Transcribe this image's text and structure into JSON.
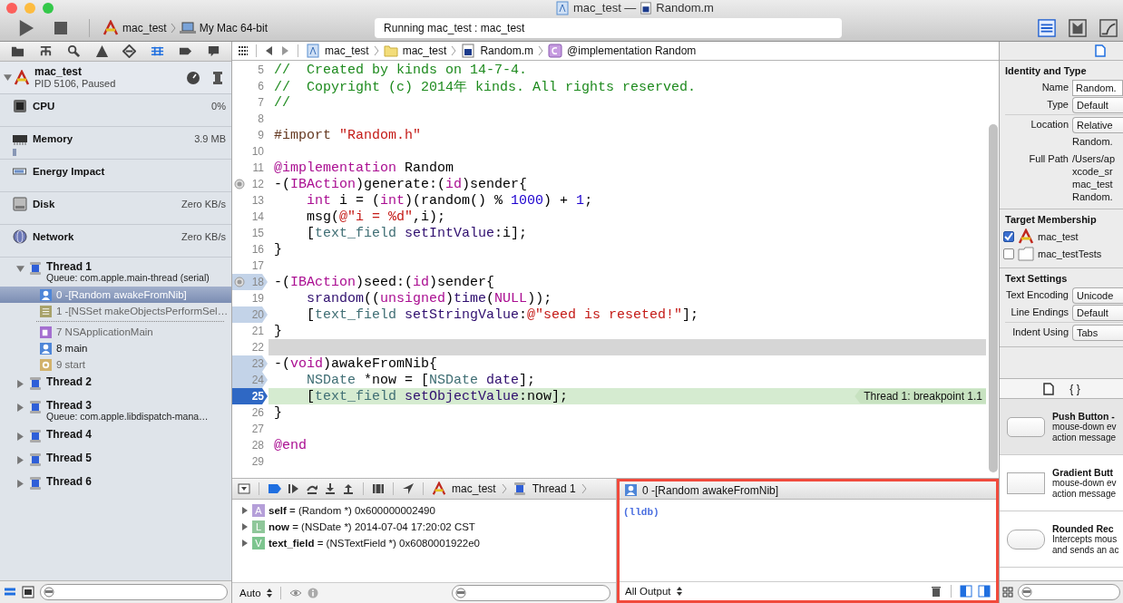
{
  "window": {
    "title_project": "mac_test —",
    "title_file": "Random.m"
  },
  "toolbar": {
    "scheme": "mac_test",
    "destination": "My Mac 64-bit",
    "activity": "Running mac_test : mac_test",
    "view_buttons": [
      {
        "kind": "navigator",
        "selected": true
      },
      {
        "kind": "debug",
        "selected": false
      },
      {
        "kind": "utilities",
        "selected": false
      }
    ]
  },
  "navigator": {
    "tabs": [
      {
        "kind": "folder",
        "selected": false
      },
      {
        "kind": "hierarchy",
        "selected": false
      },
      {
        "kind": "search",
        "selected": false
      },
      {
        "kind": "warning",
        "selected": false
      },
      {
        "kind": "test",
        "selected": false
      },
      {
        "kind": "debug",
        "selected": true
      },
      {
        "kind": "breakpoint",
        "selected": false
      },
      {
        "kind": "log",
        "selected": false
      }
    ],
    "process": {
      "name": "mac_test",
      "status": "PID 5106, Paused"
    },
    "gauges": [
      {
        "kind": "cpu",
        "name": "CPU",
        "value": "0%"
      },
      {
        "kind": "memory",
        "name": "Memory",
        "value": "3.9 MB"
      },
      {
        "kind": "energy",
        "name": "Energy Impact"
      },
      {
        "kind": "disk",
        "name": "Disk",
        "value": "Zero KB/s"
      },
      {
        "kind": "network",
        "name": "Network",
        "value": "Zero KB/s"
      }
    ],
    "threads": [
      {
        "name": "Thread 1",
        "queue": "Queue: com.apple.main-thread (serial)",
        "expanded": true,
        "frames": [
          {
            "kind": "person",
            "label": "0 -[Random awakeFromNib]",
            "selected": true,
            "dim": false
          },
          {
            "kind": "list",
            "label": "1 -[NSSet makeObjectsPerformSel…",
            "selected": false,
            "dim": true
          },
          {
            "kind": "elided"
          },
          {
            "kind": "cup",
            "label": "7 NSApplicationMain",
            "selected": false,
            "dim": true
          },
          {
            "kind": "person",
            "label": "8 main",
            "selected": false,
            "dim": false
          },
          {
            "kind": "gear",
            "label": "9 start",
            "selected": false,
            "dim": true
          }
        ]
      },
      {
        "name": "Thread 2",
        "expanded": false
      },
      {
        "name": "Thread 3",
        "queue": "Queue: com.apple.libdispatch-mana…",
        "expanded": false
      },
      {
        "name": "Thread 4",
        "expanded": false
      },
      {
        "name": "Thread 5",
        "expanded": false
      },
      {
        "name": "Thread 6",
        "expanded": false
      }
    ]
  },
  "jump_bar": [
    {
      "kind": "project",
      "text": "mac_test"
    },
    {
      "kind": "folder",
      "text": "mac_test"
    },
    {
      "kind": "file",
      "text": "Random.m"
    },
    {
      "kind": "class",
      "text": "@implementation Random"
    }
  ],
  "editor": {
    "lines": [
      {
        "number": "5",
        "kind": "plain",
        "highlighted": false,
        "current": false,
        "tokens": [
          {
            "kind": "comment",
            "text": "//  Created by kinds on 14-7-4."
          }
        ]
      },
      {
        "number": "6",
        "kind": "plain",
        "highlighted": false,
        "current": false,
        "tokens": [
          {
            "kind": "comment",
            "text": "//  Copyright (c) 2014年 kinds. All rights reserved."
          }
        ]
      },
      {
        "number": "7",
        "kind": "plain",
        "highlighted": false,
        "current": false,
        "tokens": [
          {
            "kind": "comment",
            "text": "//"
          }
        ]
      },
      {
        "number": "8",
        "kind": "plain",
        "highlighted": false,
        "current": false
      },
      {
        "number": "9",
        "kind": "plain",
        "highlighted": false,
        "current": false,
        "tokens": [
          {
            "kind": "preprocessor",
            "text": "#import "
          },
          {
            "kind": "string",
            "text": "\"Random.h\""
          }
        ]
      },
      {
        "number": "10",
        "kind": "plain",
        "highlighted": false,
        "current": false
      },
      {
        "number": "11",
        "kind": "plain",
        "highlighted": false,
        "current": false,
        "tokens": [
          {
            "kind": "keyword",
            "text": "@implementation"
          },
          {
            "kind": "plain",
            "text": " Random"
          }
        ]
      },
      {
        "number": "12",
        "kind": "circle",
        "highlighted": false,
        "current": false,
        "tokens": [
          {
            "kind": "plain",
            "text": "-("
          },
          {
            "kind": "keyword",
            "text": "IBAction"
          },
          {
            "kind": "plain",
            "text": ")generate:("
          },
          {
            "kind": "keyword",
            "text": "id"
          },
          {
            "kind": "plain",
            "text": ")sender{"
          }
        ]
      },
      {
        "number": "13",
        "kind": "plain",
        "highlighted": false,
        "current": false,
        "tokens": [
          {
            "kind": "keyword",
            "text": "    int"
          },
          {
            "kind": "plain",
            "text": " i = ("
          },
          {
            "kind": "keyword",
            "text": "int"
          },
          {
            "kind": "plain",
            "text": ")(random() % "
          },
          {
            "kind": "number",
            "text": "1000"
          },
          {
            "kind": "plain",
            "text": ") + "
          },
          {
            "kind": "number",
            "text": "1"
          },
          {
            "kind": "plain",
            "text": ";"
          }
        ]
      },
      {
        "number": "14",
        "kind": "plain",
        "highlighted": false,
        "current": false,
        "tokens": [
          {
            "kind": "plain",
            "text": "    msg("
          },
          {
            "kind": "string",
            "text": "@\"i = %d\""
          },
          {
            "kind": "plain",
            "text": ",i);"
          }
        ]
      },
      {
        "number": "15",
        "kind": "plain",
        "highlighted": false,
        "current": false,
        "tokens": [
          {
            "kind": "plain",
            "text": "    ["
          },
          {
            "kind": "type",
            "text": "text_field"
          },
          {
            "kind": "method",
            "text": " setIntValue"
          },
          {
            "kind": "plain",
            "text": ":i];"
          }
        ]
      },
      {
        "number": "16",
        "kind": "plain",
        "highlighted": false,
        "current": false,
        "tokens": [
          {
            "kind": "plain",
            "text": "}"
          }
        ]
      },
      {
        "number": "17",
        "kind": "plain",
        "highlighted": false,
        "current": false
      },
      {
        "number": "18",
        "kind": "circle_flag",
        "highlighted": false,
        "current": false,
        "tokens": [
          {
            "kind": "plain",
            "text": "-("
          },
          {
            "kind": "keyword",
            "text": "IBAction"
          },
          {
            "kind": "plain",
            "text": ")seed:("
          },
          {
            "kind": "keyword",
            "text": "id"
          },
          {
            "kind": "plain",
            "text": ")sender{"
          }
        ]
      },
      {
        "number": "19",
        "kind": "plain",
        "highlighted": false,
        "current": false,
        "tokens": [
          {
            "kind": "method",
            "text": "    srandom"
          },
          {
            "kind": "plain",
            "text": "(("
          },
          {
            "kind": "keyword",
            "text": "unsigned"
          },
          {
            "kind": "plain",
            "text": ")"
          },
          {
            "kind": "method",
            "text": "time"
          },
          {
            "kind": "plain",
            "text": "("
          },
          {
            "kind": "keyword",
            "text": "NULL"
          },
          {
            "kind": "plain",
            "text": "));"
          }
        ]
      },
      {
        "number": "20",
        "kind": "disabled",
        "highlighted": false,
        "current": false,
        "tokens": [
          {
            "kind": "plain",
            "text": "    ["
          },
          {
            "kind": "type",
            "text": "text_field"
          },
          {
            "kind": "method",
            "text": " setStringValue"
          },
          {
            "kind": "plain",
            "text": ":"
          },
          {
            "kind": "string",
            "text": "@\"seed is reseted!\""
          },
          {
            "kind": "plain",
            "text": "];"
          }
        ]
      },
      {
        "number": "21",
        "kind": "plain",
        "highlighted": false,
        "current": false,
        "tokens": [
          {
            "kind": "plain",
            "text": "}"
          }
        ]
      },
      {
        "number": "22",
        "kind": "plain",
        "highlighted": true,
        "current": false
      },
      {
        "number": "23",
        "kind": "disabled",
        "highlighted": false,
        "current": false,
        "tokens": [
          {
            "kind": "plain",
            "text": "-("
          },
          {
            "kind": "keyword",
            "text": "void"
          },
          {
            "kind": "plain",
            "text": ")awakeFromNib{"
          }
        ]
      },
      {
        "number": "24",
        "kind": "disabled",
        "highlighted": false,
        "current": false,
        "tokens": [
          {
            "kind": "type",
            "text": "    NSDate"
          },
          {
            "kind": "plain",
            "text": " *now = ["
          },
          {
            "kind": "type",
            "text": "NSDate"
          },
          {
            "kind": "method",
            "text": " date"
          },
          {
            "kind": "plain",
            "text": "];"
          }
        ]
      },
      {
        "number": "25",
        "kind": "active",
        "highlighted": false,
        "current": true,
        "note": "Thread 1: breakpoint 1.1",
        "tokens": [
          {
            "kind": "plain",
            "text": "    ["
          },
          {
            "kind": "type",
            "text": "text_field"
          },
          {
            "kind": "method",
            "text": " setObjectValue"
          },
          {
            "kind": "plain",
            "text": ":now];"
          }
        ]
      },
      {
        "number": "26",
        "kind": "plain",
        "highlighted": false,
        "current": false,
        "tokens": [
          {
            "kind": "plain",
            "text": "}"
          }
        ]
      },
      {
        "number": "27",
        "kind": "plain",
        "highlighted": false,
        "current": false
      },
      {
        "number": "28",
        "kind": "plain",
        "highlighted": false,
        "current": false,
        "tokens": [
          {
            "kind": "keyword",
            "text": "@end"
          }
        ]
      },
      {
        "number": "29",
        "kind": "plain",
        "highlighted": false,
        "current": false
      }
    ]
  },
  "debug_bar": {
    "breakpoints_active": true,
    "crumbs": [
      {
        "kind": "project",
        "text": "mac_test"
      },
      {
        "kind": "thread",
        "text": "Thread 1"
      }
    ]
  },
  "variables": [
    {
      "letter": "A",
      "color": "#b59fd9",
      "entry": "**self** = (Random *) 0x600000002490",
      "expanded": false
    },
    {
      "letter": "L",
      "color": "#8fc79a",
      "entry": "**now** = (NSDate *) 2014-07-04 17:20:02 CST",
      "expanded": false
    },
    {
      "letter": "V",
      "color": "#7dc58f",
      "entry": "**text_field** = (NSTextField *) 0x6080001922e0",
      "expanded": false
    }
  ],
  "variables_footer": {
    "scope": "Auto"
  },
  "console": {
    "frame": "0 -[Random awakeFromNib]",
    "prompt": "(lldb)",
    "filter": "All Output"
  },
  "inspector": {
    "sections": [
      {
        "title": "Identity and Type",
        "rows": [
          {
            "kind": "field",
            "label": "Name",
            "value": "Random."
          },
          {
            "kind": "popup",
            "label": "Type",
            "value": "Default"
          },
          {
            "kind": "rule"
          },
          {
            "kind": "popup",
            "label": "Location",
            "value": "Relative"
          },
          {
            "kind": "text",
            "lines": [
              "Random."
            ]
          },
          {
            "kind": "text",
            "label": "Full Path",
            "lines": [
              "/Users/ap",
              "xcode_sr",
              "mac_test",
              "Random."
            ]
          }
        ]
      },
      {
        "title": "Target Membership",
        "members": [
          {
            "name": "mac_test",
            "kind": "app",
            "checked": true
          },
          {
            "name": "mac_testTests",
            "kind": "bundle",
            "checked": false
          }
        ]
      },
      {
        "title": "Text Settings",
        "rows": [
          {
            "kind": "popup",
            "label": "Text Encoding",
            "value": "Unicode"
          },
          {
            "kind": "popup",
            "label": "Line Endings",
            "value": "Default"
          },
          {
            "kind": "rule"
          },
          {
            "kind": "popup",
            "label": "Indent Using",
            "value": "Tabs"
          }
        ]
      }
    ]
  },
  "library": {
    "braces": "{ }",
    "items": [
      {
        "kind": "push",
        "title": "Push Button -",
        "lines": [
          "mouse-down ev",
          "action message"
        ],
        "selected": true
      },
      {
        "kind": "gradient",
        "title": "Gradient Butt",
        "lines": [
          "mouse-down ev",
          "action message"
        ],
        "selected": false
      },
      {
        "kind": "rounded",
        "title": "Rounded Rec",
        "lines": [
          "Intercepts mous",
          "and sends an ac"
        ],
        "selected": false
      }
    ]
  }
}
